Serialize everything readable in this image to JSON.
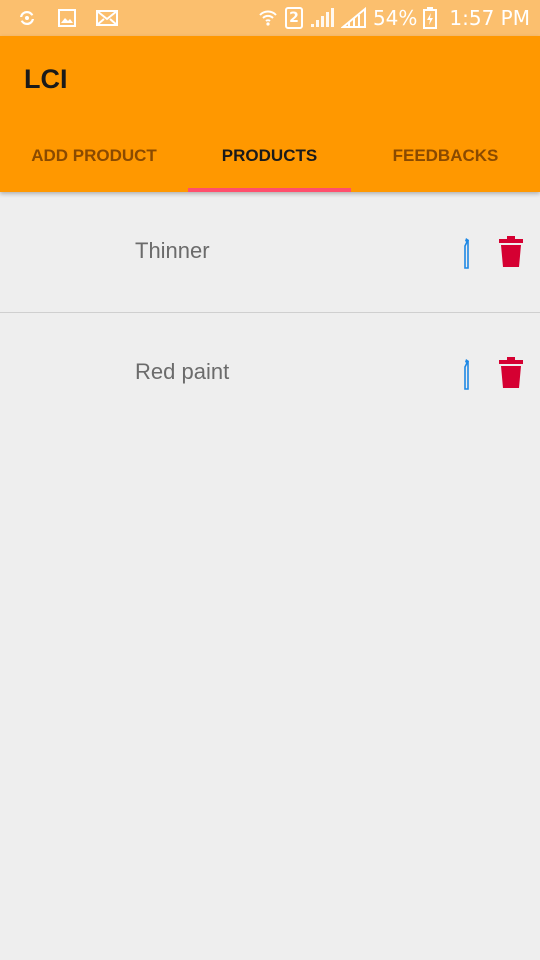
{
  "status_bar": {
    "battery_percent": "54%",
    "time": "1:57 PM",
    "sim_slot": "2",
    "icons": [
      "sync-icon",
      "image-icon",
      "mail-icon",
      "wifi-icon",
      "sim-2-icon",
      "signal-icon",
      "signal-icon",
      "battery-charging-icon"
    ]
  },
  "app": {
    "title": "LCI",
    "bar_color": "#ff9800",
    "indicator_color": "#ff4f6d"
  },
  "tabs": [
    {
      "label": "ADD PRODUCT",
      "active": false
    },
    {
      "label": "PRODUCTS",
      "active": true
    },
    {
      "label": "FEEDBACKS",
      "active": false
    }
  ],
  "products": [
    {
      "name": "Thinner"
    },
    {
      "name": "Red paint"
    }
  ],
  "colors": {
    "edit_icon": "#1e88e5",
    "delete_icon": "#d50032"
  }
}
